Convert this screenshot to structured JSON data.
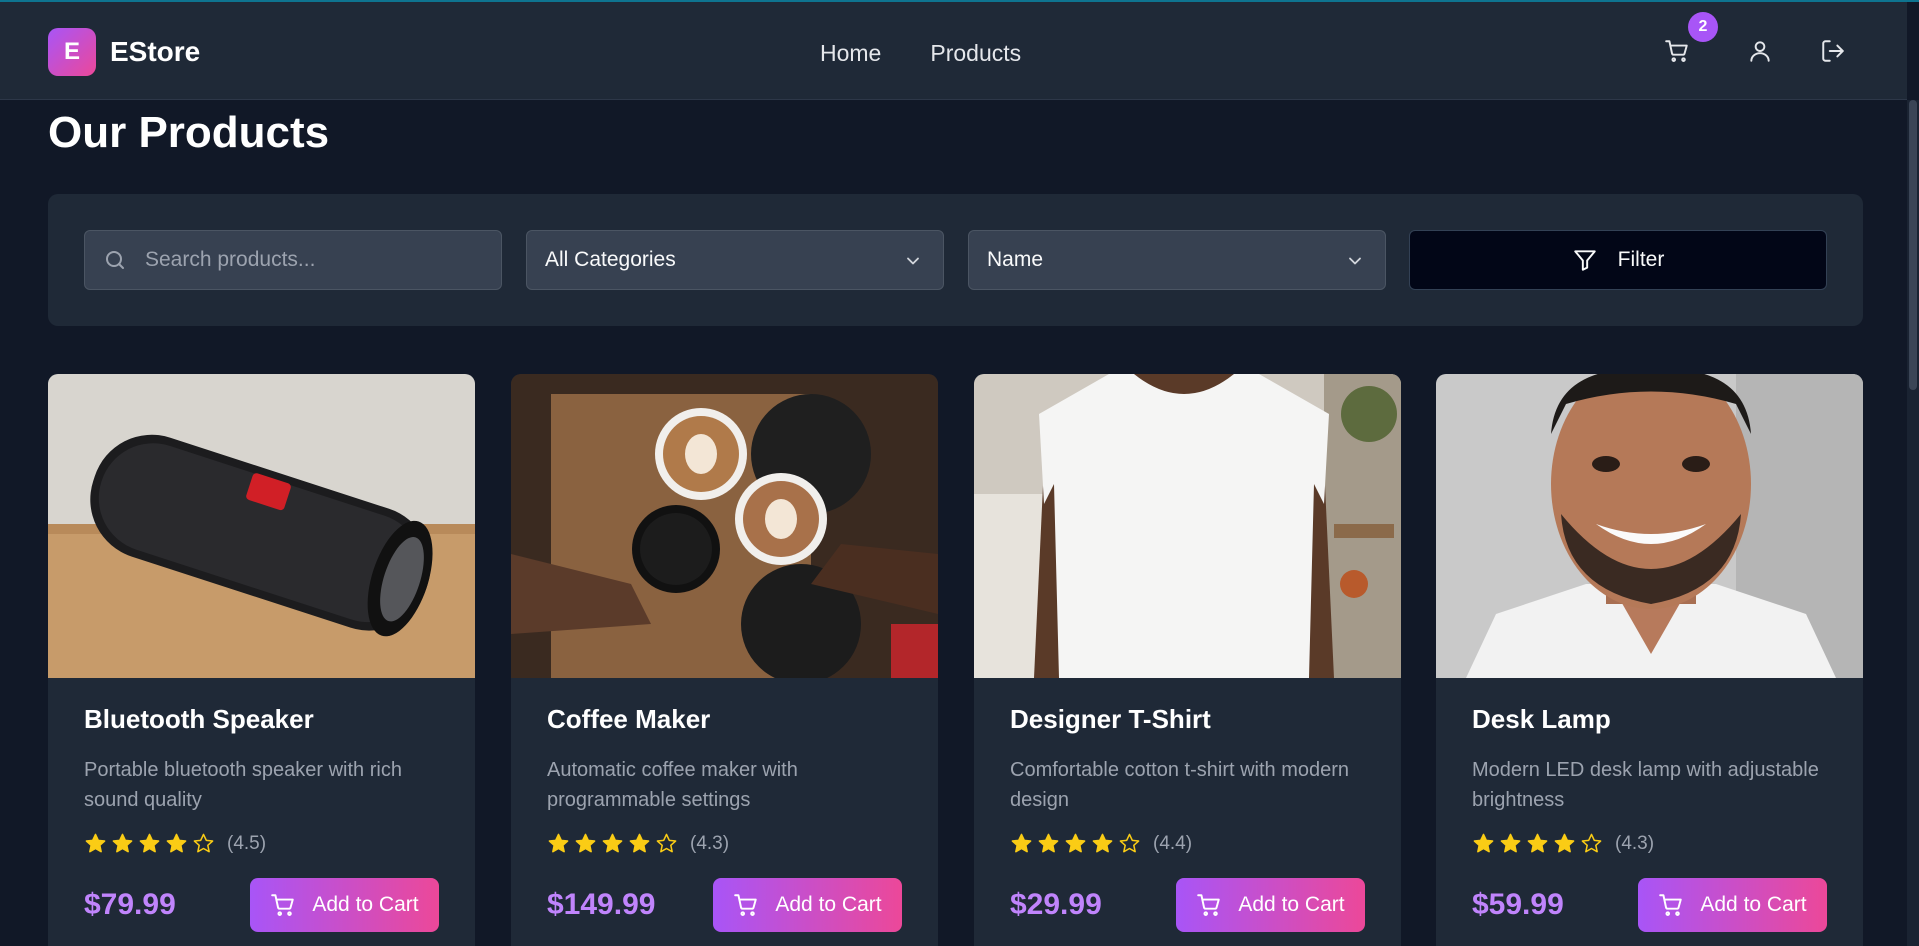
{
  "brand": {
    "logo_letter": "E",
    "name": "EStore"
  },
  "nav": {
    "home": "Home",
    "products": "Products"
  },
  "cart": {
    "count": "2"
  },
  "page": {
    "title": "Our Products"
  },
  "filters": {
    "search_placeholder": "Search products...",
    "category": "All Categories",
    "sort": "Name",
    "filter_label": "Filter"
  },
  "products": [
    {
      "name": "Bluetooth Speaker",
      "desc": "Portable bluetooth speaker with rich sound quality",
      "rating": "(4.5)",
      "rating_value": 4.5,
      "price": "$79.99",
      "cta": "Add to Cart"
    },
    {
      "name": "Coffee Maker",
      "desc": "Automatic coffee maker with programmable settings",
      "rating": "(4.3)",
      "rating_value": 4.3,
      "price": "$149.99",
      "cta": "Add to Cart"
    },
    {
      "name": "Designer T-Shirt",
      "desc": "Comfortable cotton t-shirt with modern design",
      "rating": "(4.4)",
      "rating_value": 4.4,
      "price": "$29.99",
      "cta": "Add to Cart"
    },
    {
      "name": "Desk Lamp",
      "desc": "Modern LED desk lamp with adjustable brightness",
      "rating": "(4.3)",
      "rating_value": 4.3,
      "price": "$59.99",
      "cta": "Add to Cart"
    }
  ],
  "colors": {
    "accent": "#a855f7",
    "accent2": "#ec4899",
    "star": "#facc15",
    "price": "#c084fc"
  }
}
